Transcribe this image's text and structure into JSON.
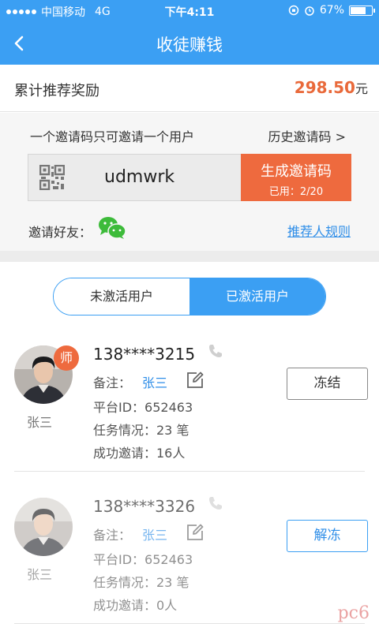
{
  "status_bar": {
    "carrier": "中国移动",
    "network": "4G",
    "time": "下午4:11",
    "battery": "67%",
    "battery_level": 0.67
  },
  "nav": {
    "title": "收徒赚钱",
    "back_icon": "chevron-left-icon"
  },
  "reward": {
    "label": "累计推荐奖励",
    "amount": "298.50",
    "unit": "元"
  },
  "invite": {
    "note": "一个邀请码只可邀请一个用户",
    "history": "历史邀请码 >",
    "code": "udmwrk",
    "generate_label": "生成邀请码",
    "used": "已用：2/20",
    "friends_label": "邀请好友：",
    "rules_link": "推荐人规则"
  },
  "tabs": {
    "inactive": "未激活用户",
    "active": "已激活用户"
  },
  "users": [
    {
      "badge": "师",
      "name": "张三",
      "phone": "138****3215",
      "remark_label": "备注：",
      "remark_value": "张三",
      "platform_id": "平台ID：652463",
      "tasks": "任务情况：23  笔",
      "invites": "成功邀请：16人",
      "action": "冻结"
    },
    {
      "name": "张三",
      "phone": "138****3326",
      "remark_label": "备注：",
      "remark_value": "张三",
      "platform_id": "平台ID：652463",
      "tasks": "任务情况：23  笔",
      "invites": "成功邀请：0人",
      "action": "解冻"
    }
  ],
  "watermark": "pc6",
  "colors": {
    "primary": "#3b9ff3",
    "accent": "#ee6a3e",
    "link": "#2f8ee8"
  }
}
